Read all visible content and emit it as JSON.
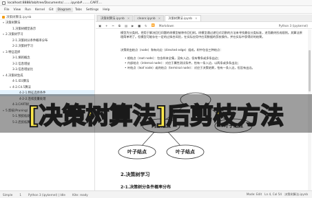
{
  "browser": {
    "url": "localhost:8888/lab/tree/Documents/........ipynb#........CART...."
  },
  "menu": [
    "File",
    "View",
    "Run",
    "Kernel",
    "Git",
    "Diagram",
    "Tabs",
    "Settings",
    "Help"
  ],
  "menu_active_index": 5,
  "left_panel": {
    "header": "决策树算法.ipynb",
    "toc": [
      {
        "label": "决策树算法",
        "level": 0,
        "arrow": "▾"
      },
      {
        "label": "1.决策树模型表示",
        "level": 1,
        "arrow": ""
      },
      {
        "label": "2.决策树学习",
        "level": 0,
        "arrow": "▾"
      },
      {
        "label": "2-1.决策树分条件概率分布",
        "level": 1,
        "arrow": ""
      },
      {
        "label": "2-2.决策树学习",
        "level": 1,
        "arrow": ""
      },
      {
        "label": "3.特征选择",
        "level": 0,
        "arrow": "▾"
      },
      {
        "label": "3-1.熵的概念",
        "level": 1,
        "arrow": ""
      },
      {
        "label": "3-2.信息增益",
        "level": 1,
        "arrow": ""
      },
      {
        "label": "3-3.信息增益比",
        "level": 1,
        "arrow": ""
      },
      {
        "label": "4.决策树生成",
        "level": 0,
        "arrow": "▾"
      },
      {
        "label": "4-1.ID3算法",
        "level": 1,
        "arrow": ""
      },
      {
        "label": "4-2.C4.5算法",
        "level": 1,
        "arrow": "▾"
      },
      {
        "label": "4-2-1.特征选择条件",
        "level": 2,
        "arrow": ""
      },
      {
        "label": "4-2-2.连续变量处理",
        "level": 2,
        "arrow": ""
      },
      {
        "label": "4-3.CART树",
        "level": 1,
        "arrow": ""
      },
      {
        "label": "5.剪枝(Pruning)",
        "level": 0,
        "arrow": "▾"
      },
      {
        "label": "5-1.预剪枝处理",
        "level": 1,
        "arrow": ""
      },
      {
        "label": "5-2.后剪枝算法",
        "level": 1,
        "arrow": ""
      }
    ]
  },
  "tabs": [
    {
      "label": "决策树算法.ipynb",
      "active": false
    },
    {
      "label": "cleanr.ipynb",
      "active": false
    },
    {
      "label": "决策树算法.ipynb",
      "active": true
    }
  ],
  "notebook_toolbar": {
    "cell_type": "Markdown",
    "kernel": "Python 3 (ipykernel)"
  },
  "content": {
    "para1": "模型为分类树。把用于解决回归问题的树模型被称作回归树。树模型通过递归式切割的方法来寻找最佳分类标准，进而最终形成规则。其算法原理简单明了。但模型可能存在一定的过拟合风险，在实际应用中应用数据的剪枝操作。并在实际中获得好的结果。",
    "para2": "决策树由结点（node）和有向边（directed edge）组成，树中包含三种结点：",
    "bullets": [
      "根结点（root node）：包含样本全集，没有入边，但有零条或多条出边；",
      "内部结点（internal node）：对应于属性测试条件，恰有一条入边，以两条或多条出边；",
      "叶结点（leaf node）或终结点（terminal node）：对应于决策结果，恰有一条入边，但没有出边。"
    ],
    "diagram": {
      "root_label": "根结点",
      "internal_label": "内部结点",
      "leaf_label": "叶子结点"
    },
    "heading2": "2.决策树学习",
    "heading3": "2-1.决策树分条件概率分布"
  },
  "status": {
    "mode": "Simple",
    "cells": "1",
    "kernel": "Python 3 (ipykernel) | Idle",
    "vim": "Kite: ready",
    "mode_right": "Mode: Edit",
    "cursor": "Ln 4, Col 54",
    "file": "决策树算法.ipynb"
  },
  "banner": "[决策树算法]后剪枝方法"
}
